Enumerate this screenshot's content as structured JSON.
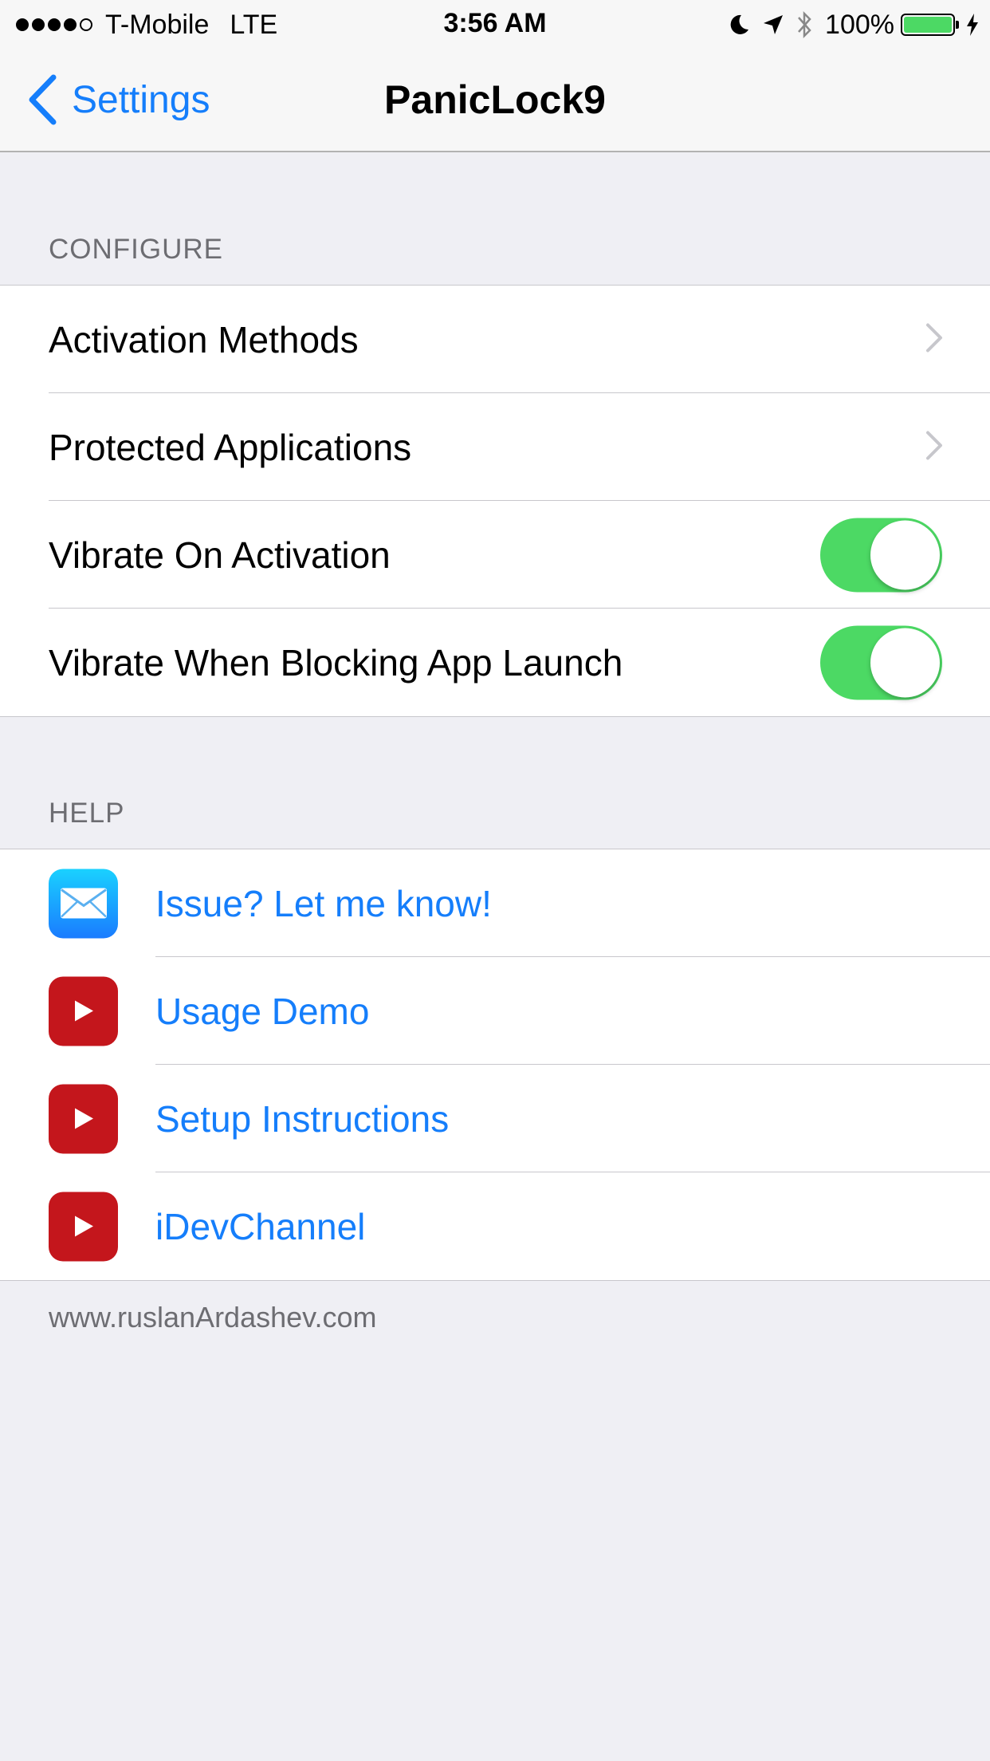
{
  "status_bar": {
    "carrier": "T-Mobile",
    "network": "LTE",
    "time": "3:56 AM",
    "battery": "100%",
    "signal_bars_filled": 4,
    "signal_bars_total": 5,
    "icons": [
      "moon-icon",
      "location-arrow-icon",
      "bluetooth-icon",
      "battery-icon",
      "charging-bolt-icon"
    ]
  },
  "nav": {
    "back_label": "Settings",
    "title": "PanicLock9"
  },
  "configure": {
    "header": "CONFIGURE",
    "activation_methods": "Activation Methods",
    "protected_applications": "Protected Applications",
    "vibrate_on_activation": {
      "label": "Vibrate On Activation",
      "on": true
    },
    "vibrate_blocking": {
      "label": "Vibrate When Blocking App Launch",
      "on": true
    }
  },
  "help": {
    "header": "HELP",
    "issue": "Issue? Let me know!",
    "usage_demo": "Usage Demo",
    "setup_instructions": "Setup Instructions",
    "idevchannel": "iDevChannel"
  },
  "footer": "www.ruslanArdashev.com",
  "colors": {
    "accent": "#157efb",
    "toggle_on": "#4cd964",
    "background": "#efeff4",
    "youtube_red": "#c4161c"
  }
}
